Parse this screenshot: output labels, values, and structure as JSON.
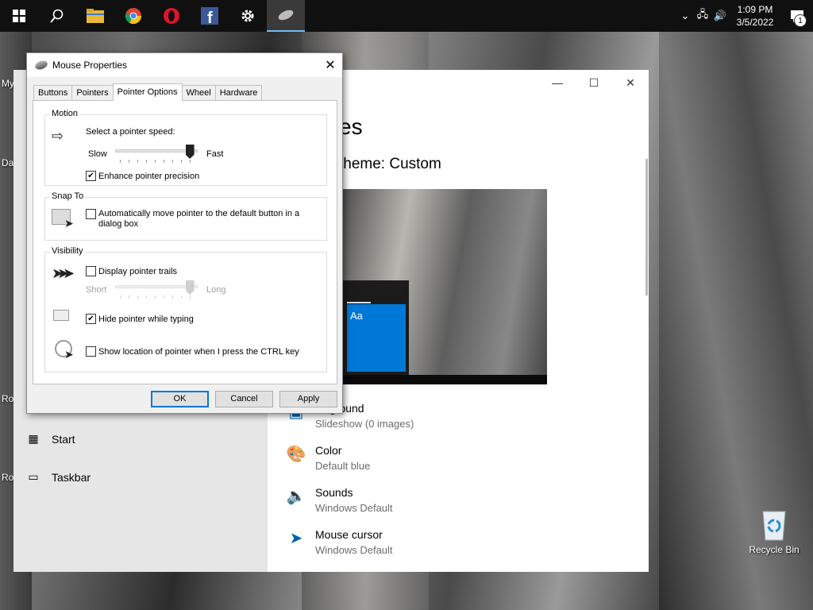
{
  "taskbar": {
    "apps": [
      {
        "name": "windows-start",
        "icon": "windows-logo-icon"
      },
      {
        "name": "search",
        "icon": "search-icon"
      },
      {
        "name": "file-explorer",
        "icon": "folder-icon"
      },
      {
        "name": "chrome",
        "icon": "chrome-icon"
      },
      {
        "name": "opera",
        "icon": "opera-icon"
      },
      {
        "name": "facebook",
        "icon": "facebook-icon"
      },
      {
        "name": "settings",
        "icon": "gear-icon"
      },
      {
        "name": "mouse",
        "icon": "mouse-icon"
      }
    ],
    "time": "1:09 PM",
    "date": "3/5/2022",
    "notification_count": "1"
  },
  "desktop": {
    "icons": [
      "My",
      "Da",
      "Ro",
      "Ro"
    ],
    "recycle_bin": "Recycle Bin"
  },
  "settings": {
    "title": "es",
    "theme": "theme: Custom",
    "preview_tile_text": "Aa",
    "sidebar": [
      {
        "label": "Start",
        "icon": "start-icon"
      },
      {
        "label": "Taskbar",
        "icon": "taskbar-icon"
      }
    ],
    "options": [
      {
        "title": "ground",
        "subtitle": "Slideshow (0 images)",
        "icon": "background-icon"
      },
      {
        "title": "Color",
        "subtitle": "Default blue",
        "icon": "palette-icon"
      },
      {
        "title": "Sounds",
        "subtitle": "Windows Default",
        "icon": "speaker-icon"
      },
      {
        "title": "Mouse cursor",
        "subtitle": "Windows Default",
        "icon": "cursor-icon"
      }
    ]
  },
  "dialog": {
    "title": "Mouse Properties",
    "tabs": [
      "Buttons",
      "Pointers",
      "Pointer Options",
      "Wheel",
      "Hardware"
    ],
    "selected_tab": "Pointer Options",
    "motion": {
      "group": "Motion",
      "prompt": "Select a pointer speed:",
      "slow": "Slow",
      "fast": "Fast",
      "speed_fraction": 0.9,
      "enhance_label": "Enhance pointer precision",
      "enhance_checked": true
    },
    "snap_to": {
      "group": "Snap To",
      "label": "Automatically move pointer to the default button in a dialog box",
      "checked": false
    },
    "visibility": {
      "group": "Visibility",
      "trails_label": "Display pointer trails",
      "trails_checked": false,
      "short": "Short",
      "long": "Long",
      "trail_fraction": 0.9,
      "hide_label": "Hide pointer while typing",
      "hide_checked": true,
      "ctrl_label": "Show location of pointer when I press the CTRL key",
      "ctrl_checked": false
    },
    "buttons": {
      "ok": "OK",
      "cancel": "Cancel",
      "apply": "Apply"
    }
  }
}
